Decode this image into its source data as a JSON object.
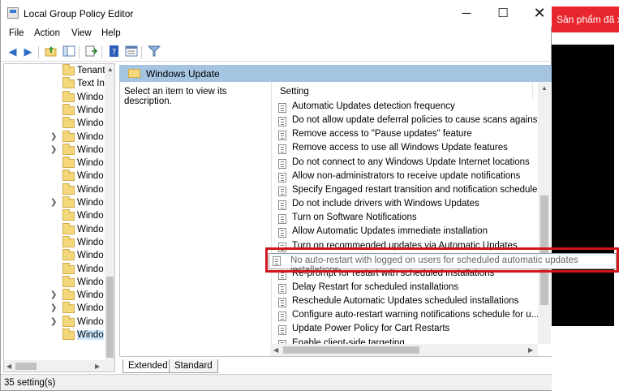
{
  "window": {
    "title": "Local Group Policy Editor",
    "controls": {
      "minimize": "─",
      "maximize": "☐",
      "close": "✕"
    }
  },
  "menu": [
    "File",
    "Action",
    "View",
    "Help"
  ],
  "toolbar": {
    "buttons": [
      "back-arrow-icon",
      "forward-arrow-icon",
      "up-folder-icon",
      "show-hide-tree-icon",
      "export-list-icon",
      "help-icon",
      "properties-icon",
      "filter-icon"
    ]
  },
  "tree": {
    "items": [
      {
        "label": "Tenant",
        "expandable": false
      },
      {
        "label": "Text In",
        "expandable": false
      },
      {
        "label": "Windo",
        "expandable": false
      },
      {
        "label": "Windo",
        "expandable": false
      },
      {
        "label": "Windo",
        "expandable": false
      },
      {
        "label": "Windo",
        "expandable": true
      },
      {
        "label": "Windo",
        "expandable": true
      },
      {
        "label": "Windo",
        "expandable": false
      },
      {
        "label": "Windo",
        "expandable": false
      },
      {
        "label": "Windo",
        "expandable": false
      },
      {
        "label": "Windo",
        "expandable": true
      },
      {
        "label": "Windo",
        "expandable": false
      },
      {
        "label": "Windo",
        "expandable": false
      },
      {
        "label": "Windo",
        "expandable": false
      },
      {
        "label": "Windo",
        "expandable": false
      },
      {
        "label": "Windo",
        "expandable": false
      },
      {
        "label": "Windo",
        "expandable": false
      },
      {
        "label": "Windo",
        "expandable": true
      },
      {
        "label": "Windo",
        "expandable": true
      },
      {
        "label": "Windo",
        "expandable": true
      },
      {
        "label": "Windo",
        "expandable": false,
        "selected": true
      }
    ]
  },
  "panel": {
    "title": "Windows Update",
    "description": "Select an item to view its description.",
    "column_header": "Setting",
    "settings": [
      "Automatic Updates detection frequency",
      "Do not allow update deferral policies to cause scans against ...",
      "Remove access to \"Pause updates\" feature",
      "Remove access to use all Windows Update features",
      "Do not connect to any Windows Update Internet locations",
      "Allow non-administrators to receive update notifications",
      "Specify Engaged restart transition and notification schedule ...",
      "Do not include drivers with Windows Updates",
      "Turn on Software Notifications",
      "Allow Automatic Updates immediate installation",
      "Turn on recommended updates via Automatic Updates",
      "",
      "Re-prompt for restart with scheduled installations",
      "Delay Restart for scheduled installations",
      "Reschedule Automatic Updates scheduled installations",
      "Configure auto-restart warning notifications schedule for u...",
      "Update Power Policy for Cart Restarts",
      "Enable client-side targeting"
    ],
    "highlighted_setting": "No auto-restart with logged on users for scheduled automatic updates installations"
  },
  "tabs": [
    "Extended",
    "Standard"
  ],
  "status": "35 setting(s)",
  "background_banner": "Sản phẩm đã x",
  "colors": {
    "panel_header": "#a4c4e2",
    "highlight_border": "#d0161c",
    "banner": "#e8262e"
  }
}
